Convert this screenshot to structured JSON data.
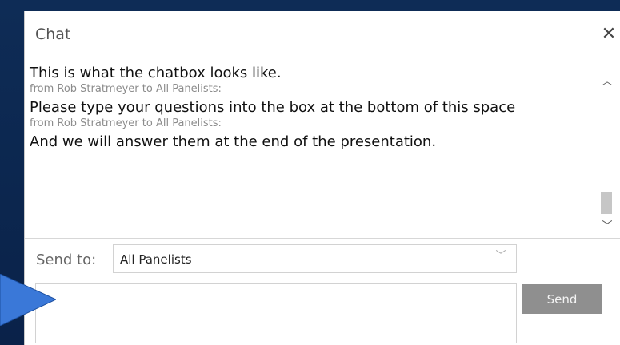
{
  "chat": {
    "title": "Chat",
    "close_icon": "close-icon",
    "messages": [
      {
        "text": "This is what the chatbox looks like."
      },
      {
        "from": "from Rob Stratmeyer to All Panelists:",
        "text": "Please type your questions into the box at the bottom of this space"
      },
      {
        "from": "from Rob Stratmeyer to All Panelists:",
        "text": "And we will answer them at the end of the presentation."
      }
    ],
    "send_to_label": "Send to:",
    "send_to_value": "All Panelists",
    "message_placeholder": "",
    "send_label": "Send"
  },
  "colors": {
    "background": "#0d2a52",
    "panel": "#ffffff",
    "send_button": "#8f8f8f",
    "arrow": "#3a78d8"
  }
}
